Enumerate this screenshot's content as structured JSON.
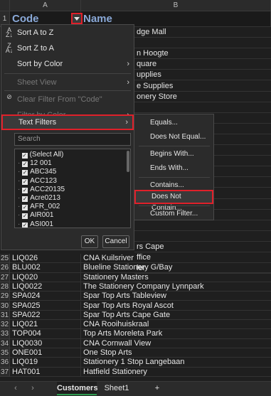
{
  "columns": [
    "A",
    "B"
  ],
  "headers": {
    "row": "1",
    "code": "Code",
    "name": "Name"
  },
  "visible_name_fragments": [
    {
      "row": "2",
      "text": "dge Mall"
    },
    {
      "row": "4",
      "text": "n Hoogte"
    },
    {
      "row": "5",
      "text": "quare"
    },
    {
      "row": "6",
      "text": "upplies"
    },
    {
      "row": "7",
      "text": "e Supplies"
    },
    {
      "row": "8",
      "text": "onery Store"
    },
    {
      "row": "10",
      "text": "ust"
    },
    {
      "row": "22",
      "text": "rs Cape"
    },
    {
      "row": "23",
      "text": "ffice"
    },
    {
      "row": "24",
      "text": "ler"
    }
  ],
  "rows": [
    {
      "num": "25",
      "code": "LIQ026",
      "name": "CNA Kuilsriver"
    },
    {
      "num": "26",
      "code": "BLU002",
      "name": "Blueline Stationery G/Bay"
    },
    {
      "num": "27",
      "code": "LIQ020",
      "name": "Stationery Masters"
    },
    {
      "num": "28",
      "code": "LIQ0022",
      "name": "The Stationery Company Lynnpark"
    },
    {
      "num": "29",
      "code": "SPA024",
      "name": "Spar Top Arts Tableview"
    },
    {
      "num": "30",
      "code": "SPA025",
      "name": "Spar Top Arts Royal Ascot"
    },
    {
      "num": "31",
      "code": "SPA022",
      "name": "Spar Top Arts Cape Gate"
    },
    {
      "num": "32",
      "code": "LIQ021",
      "name": "CNA Rooihuiskraal"
    },
    {
      "num": "33",
      "code": "TOP004",
      "name": "Top Arts Moreleta Park"
    },
    {
      "num": "34",
      "code": "LIQ0030",
      "name": "CNA Cornwall View"
    },
    {
      "num": "35",
      "code": "ONE001",
      "name": "One Stop Arts"
    },
    {
      "num": "36",
      "code": "LIQ019",
      "name": "Stationery 1 Stop Langebaan"
    },
    {
      "num": "37",
      "code": "HAT001",
      "name": "Hatfield Stationery"
    }
  ],
  "menu": {
    "sort_az": "Sort A to Z",
    "sort_za": "Sort Z to A",
    "sort_color": "Sort by Color",
    "sheet_view": "Sheet View",
    "clear_filter": "Clear Filter From \"Code\"",
    "filter_color": "Filter by Color",
    "text_filters": "Text Filters",
    "search_placeholder": "Search",
    "values": [
      "(Select All)",
      "12 001",
      "ABC345",
      "ACC123",
      "ACC20135",
      "Acre0213",
      "AFR_002",
      "AIR001",
      "ASI001"
    ],
    "ok": "OK",
    "cancel": "Cancel"
  },
  "submenu": {
    "equals": "Equals...",
    "not_equal": "Does Not Equal...",
    "begins_with": "Begins With...",
    "ends_with": "Ends With...",
    "contains": "Contains...",
    "not_contain": "Does Not Contain...",
    "custom": "Custom Filter..."
  },
  "tabs": {
    "customers": "Customers",
    "sheet1": "Sheet1",
    "add": "+"
  },
  "colors": {
    "highlight": "#e0202a",
    "header_text": "#8aa9d8",
    "active_tab": "#2e9b4f"
  }
}
